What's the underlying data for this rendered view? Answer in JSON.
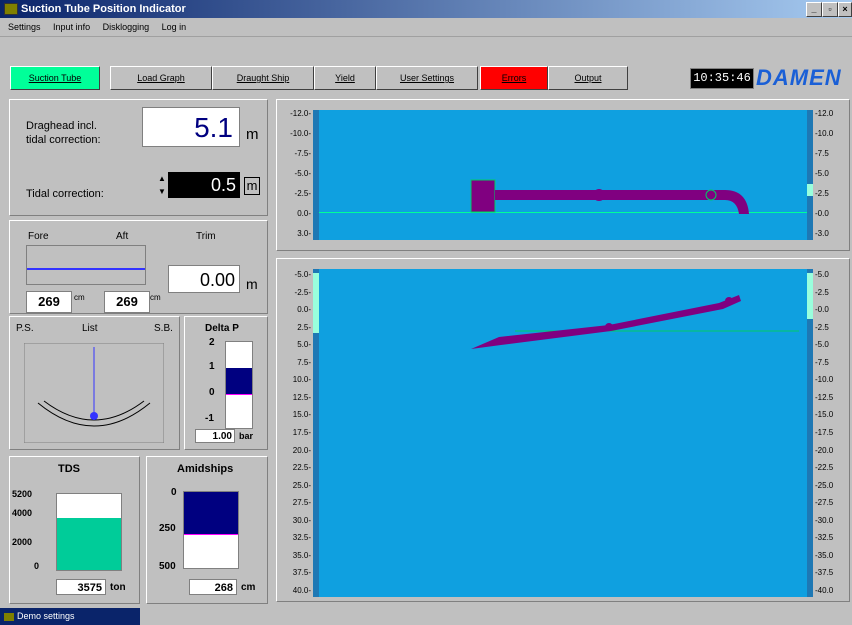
{
  "window": {
    "title": "Suction Tube Position Indicator",
    "controls": [
      "_",
      "̅",
      "×"
    ]
  },
  "menu": [
    "Settings",
    "Input info",
    "Disklogging",
    "Log in"
  ],
  "tabs": [
    {
      "label": "Suction Tube",
      "color": "#00ff99"
    },
    {
      "label": "Load Graph",
      "color": "#c0c0c0"
    },
    {
      "label": "Draught Ship",
      "color": "#c0c0c0"
    },
    {
      "label": "Yield",
      "color": "#c0c0c0"
    },
    {
      "label": "User Settings",
      "color": "#c0c0c0"
    },
    {
      "label": "Errors",
      "color": "#ff0000"
    },
    {
      "label": "Output",
      "color": "#c0c0c0"
    }
  ],
  "clock": "10:35:46",
  "logo": "DAMEN",
  "draghead": {
    "label1": "Draghead incl.",
    "label2": "tidal correction:",
    "value": "5.1",
    "unit": "m"
  },
  "tidal": {
    "label": "Tidal correction:",
    "value": "0.5",
    "unit": "m"
  },
  "draught": {
    "fore": "Fore",
    "aft": "Aft",
    "trim": "Trim",
    "trim_value": "0.00",
    "trim_unit": "m",
    "fore_value": "269",
    "aft_value": "269",
    "unit": "cm"
  },
  "list": {
    "ps": "P.S.",
    "title": "List",
    "sb": "S.B."
  },
  "deltap": {
    "title": "Delta P",
    "ticks": [
      "2",
      "1",
      "0",
      "-1"
    ],
    "value": "1.00",
    "unit": "bar"
  },
  "tds": {
    "title": "TDS",
    "ticks": [
      "5200",
      "4000",
      "2000",
      "0"
    ],
    "value": "3575",
    "unit": "ton",
    "fill_fraction": 0.69,
    "color": "#00cc99"
  },
  "amidships": {
    "title": "Amidships",
    "ticks": [
      "0",
      "250",
      "500"
    ],
    "value": "268",
    "unit": "cm",
    "fill_fraction": 0.54,
    "color": "#000080"
  },
  "top_plot": {
    "ticks": [
      "-12.0",
      "-10.0",
      "-7.5",
      "-5.0",
      "-2.5",
      "0.0",
      "3.0"
    ],
    "right_ticks": [
      "-12.0",
      "-10.0",
      "-7.5",
      "-5.0",
      "-2.5",
      "-0.0",
      "-3.0"
    ]
  },
  "bottom_plot": {
    "ticks": [
      "-5.0",
      "-2.5",
      "0.0",
      "2.5",
      "5.0",
      "7.5",
      "10.0",
      "12.5",
      "15.0",
      "17.5",
      "20.0",
      "22.5",
      "25.0",
      "27.5",
      "30.0",
      "32.5",
      "35.0",
      "37.5",
      "40.0"
    ],
    "right_ticks": [
      "-5.0",
      "-2.5",
      "-0.0",
      "-2.5",
      "-5.0",
      "-7.5",
      "-10.0",
      "-12.5",
      "-15.0",
      "-17.5",
      "-20.0",
      "-22.5",
      "-25.0",
      "-27.5",
      "-30.0",
      "-32.5",
      "-35.0",
      "-37.5",
      "-40.0"
    ]
  },
  "taskbar": {
    "label": "Demo settings"
  }
}
